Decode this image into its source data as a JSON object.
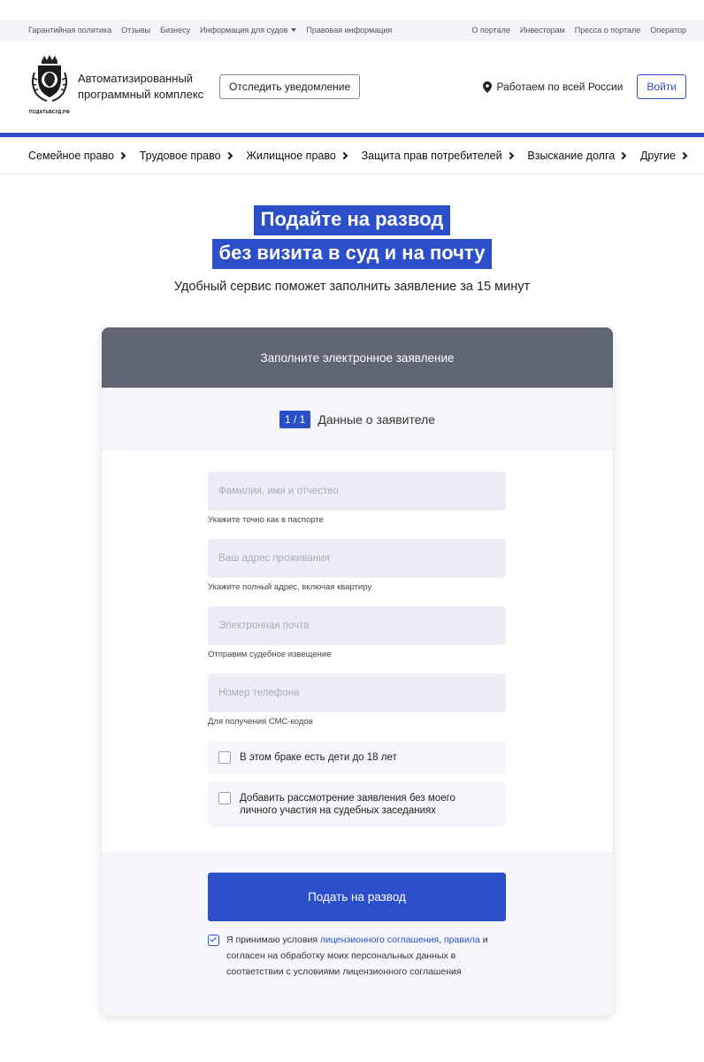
{
  "topbar": {
    "left": [
      "Гарантийная политика",
      "Отзывы",
      "Бизнесу"
    ],
    "dropdown": "Информация для судов",
    "legal": "Правовая информация",
    "right": [
      "О портале",
      "Инвесторам",
      "Пресса о портале",
      "Оператор"
    ]
  },
  "header": {
    "logo_caption": "ПОДАТЬВСУД.РФ",
    "brand_line1": "Автоматизированный",
    "brand_line2": "программный комплекс",
    "track_button": "Отследить уведомление",
    "region": "Работаем по всей России",
    "login_button": "Войти"
  },
  "categories": [
    "Семейное право",
    "Трудовое право",
    "Жилищное право",
    "Защита прав потребителей",
    "Взыскание долга",
    "Другие"
  ],
  "hero": {
    "line1": "Подайте на развод",
    "line2": "без визита в суд и на почту",
    "subtitle": "Удобный сервис поможет заполнить заявление за 15 минут"
  },
  "form": {
    "header": "Заполните электронное заявление",
    "step_badge": "1 / 1",
    "step_title": "Данные о заявителе",
    "fields": [
      {
        "placeholder": "Фамилия, имя и отчество",
        "hint": "Укажите точно как в паспорте"
      },
      {
        "placeholder": "Ваш адрес проживания",
        "hint": "Укажите полный адрес, включая квартиру"
      },
      {
        "placeholder": "Электронная почта",
        "hint": "Отправим судебное извещение"
      },
      {
        "placeholder": "Номер телефона",
        "hint": "Для получения СМС-кодов"
      }
    ],
    "checkbox_children": "В этом браке есть дети до 18 лет",
    "checkbox_absent": "Добавить рассмотрение заявления без моего личного участия на судебных заседаниях",
    "submit": "Подать на развод",
    "consent": {
      "prefix": "Я принимаю условия ",
      "link1": "лицензионного соглашения",
      "comma": ",",
      "link2": "правила",
      "rest": " и согласен на обработку моих персональных данных в соответствии с условиями лицензионного соглашения"
    }
  },
  "colors": {
    "accent": "#2a4fc9",
    "form_header": "#5f6572",
    "field_bg": "#ecedf4"
  }
}
